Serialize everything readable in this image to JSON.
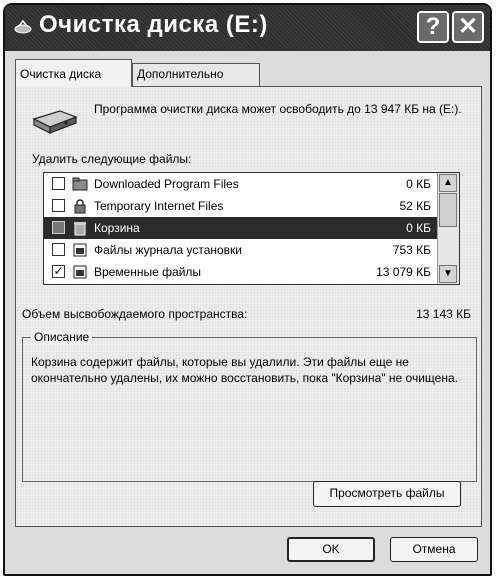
{
  "window": {
    "title": "Очистка диска  (E:)",
    "help_button": "?",
    "close_button": "✕"
  },
  "tabs": [
    {
      "label": "Очистка диска",
      "active": true
    },
    {
      "label": "Дополнительно",
      "active": false
    }
  ],
  "intro_text": "Программа очистки диска может освободить до 13 947 КБ на (E:).",
  "files_label": "Удалить следующие файлы:",
  "files": [
    {
      "name": "Downloaded Program Files",
      "size": "0 КБ",
      "checked": false,
      "icon": "folder-icon"
    },
    {
      "name": "Temporary Internet Files",
      "size": "52 КБ",
      "checked": false,
      "icon": "lock-icon"
    },
    {
      "name": "Корзина",
      "size": "0 КБ",
      "checked": false,
      "selected": true,
      "icon": "recycle-bin-icon"
    },
    {
      "name": "Файлы журнала установки",
      "size": "753 КБ",
      "checked": false,
      "icon": "file-icon"
    },
    {
      "name": "Временные файлы",
      "size": "13 079 КБ",
      "checked": true,
      "icon": "file-icon"
    }
  ],
  "space_label": "Объем высвобождаемого пространства:",
  "space_value": "13 143 КБ",
  "description": {
    "legend": "Описание",
    "text": "Корзина содержит файлы, которые вы удалили. Эти файлы еще не окончательно удалены, их можно восстановить, пока \"Корзина\" не очищена."
  },
  "buttons": {
    "view_files": "Просмотреть файлы",
    "ok": "OK",
    "cancel": "Отмена"
  }
}
